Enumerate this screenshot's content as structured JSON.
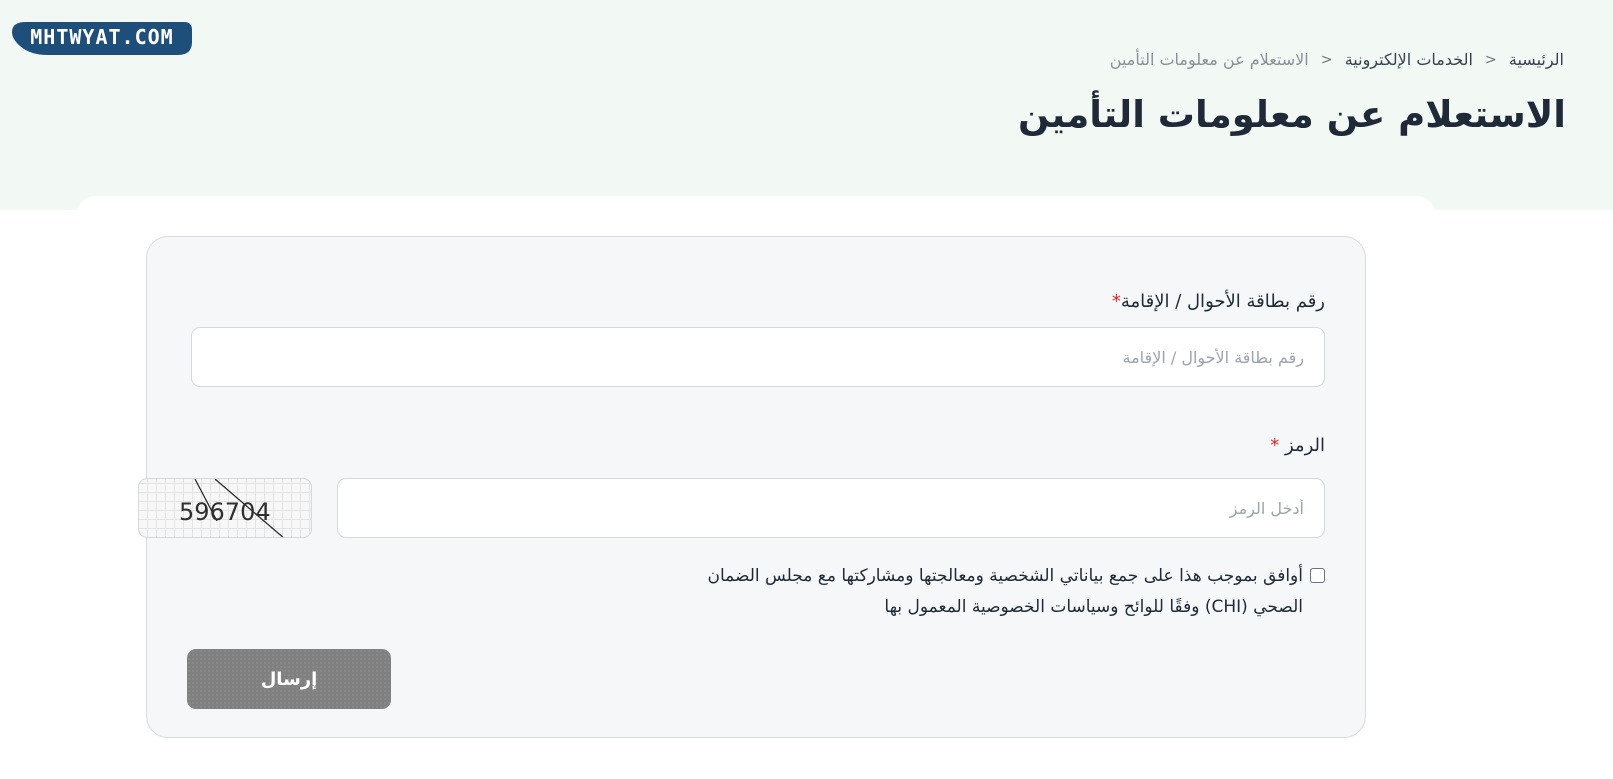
{
  "site": {
    "logo_text": "MHTWYAT.COM",
    "brand_color": "#1d4f7a"
  },
  "breadcrumb": {
    "items": [
      {
        "label": "الرئيسية"
      },
      {
        "label": "الخدمات الإلكترونية"
      },
      {
        "label": "الاستعلام عن معلومات التأمين"
      }
    ],
    "separator": "<"
  },
  "page": {
    "title": "الاستعلام عن معلومات التأمين"
  },
  "form": {
    "id_field": {
      "label": "رقم بطاقة الأحوال / الإقامة",
      "required_mark": "*",
      "placeholder": "رقم بطاقة الأحوال / الإقامة",
      "value": ""
    },
    "code_field": {
      "label": "الرمز",
      "required_mark": "*",
      "placeholder": "أدخل الرمز",
      "value": "",
      "captcha_text": "596704"
    },
    "consent": {
      "checked": false,
      "text": "أوافق بموجب هذا على جمع بياناتي الشخصية ومعالجتها ومشاركتها مع مجلس الضمان الصحي (CHI) وفقًا للوائح وسياسات الخصوصية المعمول بها"
    },
    "submit_label": "إرسال"
  },
  "colors": {
    "hero_bg": "#f2f9f5",
    "panel_bg": "#f6f7f8",
    "required": "#dc2626",
    "button_disabled": "#808080"
  }
}
